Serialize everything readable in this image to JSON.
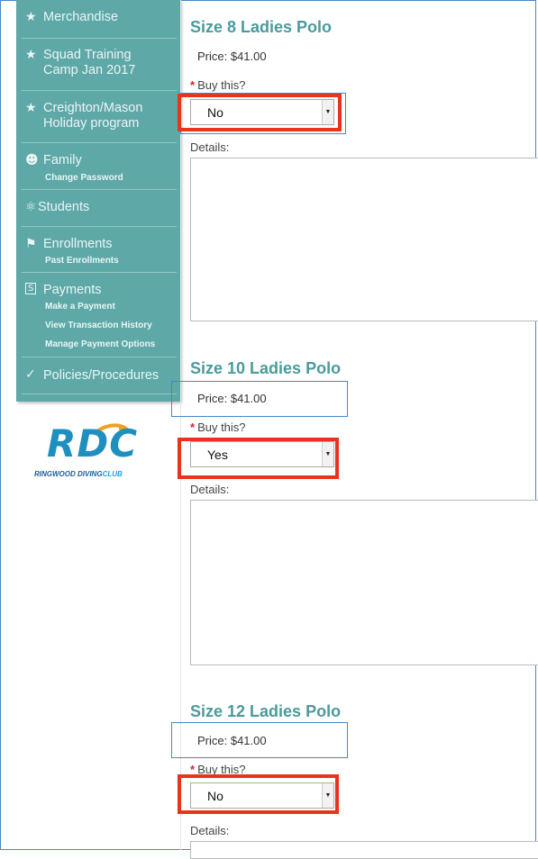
{
  "sidebar": {
    "items": [
      {
        "icon": "star-icon",
        "glyph": "★",
        "label": "Merchandise"
      },
      {
        "icon": "star-icon",
        "glyph": "★",
        "label": "Squad Training Camp Jan 2017"
      },
      {
        "icon": "star-icon",
        "glyph": "★",
        "label": "Creighton/Mason Holiday program"
      },
      {
        "icon": "family-icon",
        "glyph": "👪",
        "label": "Family",
        "sub": [
          "Change Password"
        ]
      },
      {
        "icon": "students-icon",
        "glyph": "♞",
        "label": "Students"
      },
      {
        "icon": "enrollments-icon",
        "glyph": "⚇",
        "label": "Enrollments",
        "sub": [
          "Past Enrollments"
        ]
      },
      {
        "icon": "payments-icon",
        "glyph": "S",
        "label": "Payments",
        "sub": [
          "Make a Payment",
          "View Transaction History",
          "Manage Payment Options"
        ]
      },
      {
        "icon": "checkmark-icon",
        "glyph": "✓",
        "label": "Policies/Procedures"
      }
    ],
    "logo": {
      "letters": "RDC",
      "name_part1": "RINGWOOD DIVING",
      "name_part2": "CLUB"
    }
  },
  "products": [
    {
      "title": "Size 8 Ladies Polo",
      "price": "Price: $41.00",
      "buy_label": "Buy this?",
      "required_mark": "*",
      "selected": "No",
      "details_label": "Details:"
    },
    {
      "title": "Size 10 Ladies Polo",
      "price": "Price: $41.00",
      "buy_label": "Buy this?",
      "required_mark": "*",
      "selected": "Yes",
      "details_label": "Details:"
    },
    {
      "title": "Size 12 Ladies Polo",
      "price": "Price: $41.00",
      "buy_label": "Buy this?",
      "required_mark": "*",
      "selected": "No",
      "details_label": "Details:"
    }
  ],
  "colors": {
    "sidebar": "#5ea8a8",
    "title": "#4c9a9b",
    "highlight_red": "#e8341c",
    "highlight_blue": "#4a86c8",
    "required": "#d9252a"
  }
}
